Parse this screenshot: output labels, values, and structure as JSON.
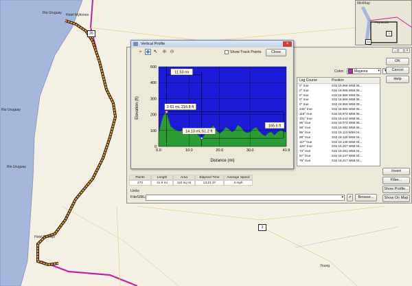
{
  "map": {
    "labels": {
      "rio_uruguay_top": "Rio Uruguay",
      "hotel_mykonos": "Hotel Mykonos",
      "rio_uruguay_left": "Rio Uruguay",
      "rio_uruguay_mid": "Rio Uruguay",
      "hotel_pt_viejo": "Hotel Pt Viejo",
      "young": "Young"
    },
    "shields": {
      "s26": "26",
      "s3": "3"
    },
    "track_color": "#f0a030",
    "road_color": "#c21fa0"
  },
  "minimap": {
    "title": "MiniMap",
    "label": "Paysandu",
    "shield14": "14",
    "shield3": "3"
  },
  "track_properties": {
    "ok": "OK",
    "cancel": "Cancel",
    "help": "Help",
    "color_label": "Color:",
    "color_value": "Magenta",
    "color_hex": "#d41ab4",
    "leg_course_header": "Leg Course",
    "position_header": "Position",
    "rows": [
      {
        "course": "0° true",
        "position": "S32 18.966 W58 05..."
      },
      {
        "course": "0° true",
        "position": "S32 18.966 W58 05..."
      },
      {
        "course": "0° true",
        "position": "S32 18.966 W58 05..."
      },
      {
        "course": "0° true",
        "position": "S32 18.966 W58 05..."
      },
      {
        "course": "0° true",
        "position": "S32 18.966 W58 05..."
      },
      {
        "course": "248° true",
        "position": "S32 18.966 W58 05..."
      },
      {
        "course": "119° true",
        "position": "S32 18.974 W58 05..."
      },
      {
        "course": "101° true",
        "position": "S32 19.044 W58 05..."
      },
      {
        "course": "96° true",
        "position": "S32 19.074 W58 05..."
      },
      {
        "course": "98° true",
        "position": "S32 19.092 W58 05..."
      },
      {
        "course": "95° true",
        "position": "S32 19.113 W58 04..."
      },
      {
        "course": "98° true",
        "position": "S32 19.128 W58 04..."
      },
      {
        "course": "117° true",
        "position": "S32 19.148 W58 04..."
      },
      {
        "course": "129° true",
        "position": "S32 19.207 W58 04..."
      },
      {
        "course": "73° true",
        "position": "S32 19.281 W58 04..."
      },
      {
        "course": "67° true",
        "position": "S32 19.247 W58 04..."
      },
      {
        "course": "79° true",
        "position": "S32 19.217 W58 04..."
      }
    ],
    "invert": "Invert",
    "filter": "Filter...",
    "show_profile": "Show Profile...",
    "show_on_map": "Show On Map",
    "stats_headers": [
      "Points",
      "Length",
      "Area",
      "Elapsed Time",
      "Average Speed"
    ],
    "stats_values": [
      "270",
      "41.9 mi",
      "110 sq mi",
      "13:21:37",
      "3 mph"
    ],
    "links_label": "Links",
    "file_url_label": "File/URL:",
    "browse": "Browse..."
  },
  "vertical_profile": {
    "title": "Vertical Profile",
    "show_track_points": "Show Track Points",
    "close": "Close",
    "ylabel": "Elevation (ft)",
    "xlabel": "Distance   (mi)",
    "annotations": {
      "span": "11.53 mi",
      "peak": "2.61 mi, 216.8 ft",
      "low": "14.13 mi, 51.2 ft",
      "diff": "165.6 ft"
    },
    "bg_color": "#1c1cd6",
    "fill_color": "#2c9c34"
  },
  "chart_data": {
    "type": "area",
    "title": "",
    "xlabel": "Distance (mi)",
    "ylabel": "Elevation (ft)",
    "xlim": [
      0,
      41.9
    ],
    "ylim": [
      0,
      500
    ],
    "xticks": [
      "0.0",
      "10.0",
      "20.0",
      "30.0",
      "41.9"
    ],
    "yticks": [
      "0",
      "100",
      "200",
      "300",
      "400",
      "500"
    ],
    "series": [
      {
        "x": [
          0,
          0.5,
          1.0,
          1.5,
          2.0,
          2.61,
          3.2,
          4.0,
          5.0,
          6.0,
          7.0,
          8.0,
          9.0,
          10.0,
          11.0,
          12.0,
          13.0,
          14.13,
          15.0,
          16.0,
          17.0,
          18.0,
          19.0,
          20.0,
          21.0,
          22.0,
          23.0,
          24.0,
          25.0,
          26.0,
          27.0,
          28.0,
          29.0,
          30.0,
          31.0,
          32.0,
          33.0,
          34.0,
          35.0,
          36.0,
          37.0,
          38.0,
          39.0,
          40.0,
          41.0,
          41.9
        ],
        "y": [
          80,
          120,
          160,
          190,
          205,
          216.8,
          170,
          125,
          110,
          100,
          95,
          105,
          110,
          100,
          95,
          85,
          70,
          51.2,
          70,
          90,
          110,
          130,
          100,
          80,
          95,
          120,
          110,
          90,
          100,
          135,
          120,
          95,
          85,
          90,
          110,
          120,
          95,
          75,
          65,
          85,
          90,
          70,
          90,
          100,
          95,
          85
        ]
      }
    ],
    "grid": true
  }
}
